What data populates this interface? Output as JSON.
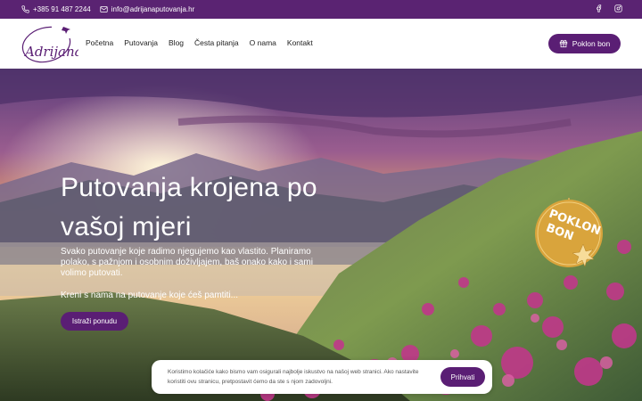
{
  "topbar": {
    "phone": "+385 91 487 2244",
    "email": "info@adrijanaputovanja.hr",
    "social_icons": [
      "facebook-icon",
      "instagram-icon"
    ]
  },
  "header": {
    "logo_text": "Adrijana",
    "nav": [
      "Početna",
      "Putovanja",
      "Blog",
      "Česta pitanja",
      "O nama",
      "Kontakt"
    ],
    "gift_button": "Poklon bon"
  },
  "hero": {
    "title": "Putovanja krojena po vašoj mjeri",
    "text": "Svako putovanje koje radimo njegujemo kao vlastito. Planiramo polako, s pažnjom i osobnim doživljajem, baš onako kako i sami volimo putovati.",
    "subtext": "Kreni s nama na putovanje koje ćeš pamtiti...",
    "cta": "Istraži ponudu",
    "badge_line1": "POKLON",
    "badge_line2": "BON"
  },
  "cookie": {
    "message": "Koristimo kolačiće kako bismo vam osigurali najbolje iskustvo na našoj web stranici. Ako nastavite koristiti ovu stranicu, pretpostavit ćemo da ste s njom zadovoljni.",
    "accept": "Prihvati"
  },
  "colors": {
    "brand_purple": "#5a1e74",
    "topbar_purple": "#5a2372",
    "badge_gold": "#d9a43c"
  }
}
